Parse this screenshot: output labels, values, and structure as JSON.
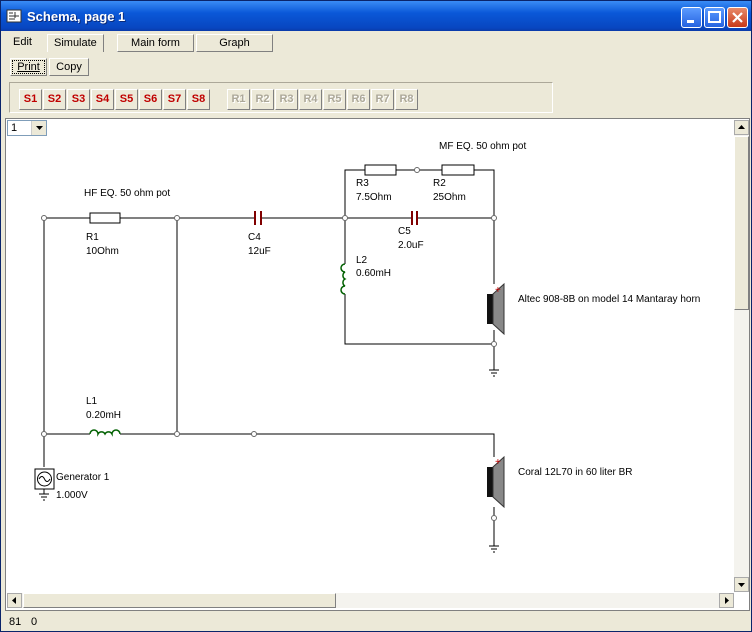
{
  "window": {
    "title": "Schema, page 1"
  },
  "menu": {
    "edit": "Edit",
    "simulate": "Simulate",
    "main_form": "Main form",
    "graph": "Graph"
  },
  "toolbar": {
    "print": "Print",
    "copy": "Copy"
  },
  "s_buttons": [
    "S1",
    "S2",
    "S3",
    "S4",
    "S5",
    "S6",
    "S7",
    "S8"
  ],
  "r_buttons": [
    "R1",
    "R2",
    "R3",
    "R4",
    "R5",
    "R6",
    "R7",
    "R8"
  ],
  "page_select": {
    "value": "1"
  },
  "schematic": {
    "hf_eq": "HF EQ. 50 ohm pot",
    "mf_eq": "MF EQ. 50 ohm pot",
    "r1_name": "R1",
    "r1_value": "10Ohm",
    "r2_name": "R2",
    "r2_value": "25Ohm",
    "r3_name": "R3",
    "r3_value": "7.5Ohm",
    "c4_name": "C4",
    "c4_value": "12uF",
    "c5_name": "C5",
    "c5_value": "2.0uF",
    "l1_name": "L1",
    "l1_value": "0.20mH",
    "l2_name": "L2",
    "l2_value": "0.60mH",
    "gen_name": "Generator 1",
    "gen_value": "1.000V",
    "spk1": "Altec 908-8B on model 14 Mantaray horn",
    "spk2": "Coral 12L70 in 60 liter BR"
  },
  "status": {
    "x": "81",
    "y": "0"
  },
  "colors": {
    "wire": "#000000",
    "capacitor": "#800000",
    "inductor": "#006000",
    "red": "#c00000"
  }
}
